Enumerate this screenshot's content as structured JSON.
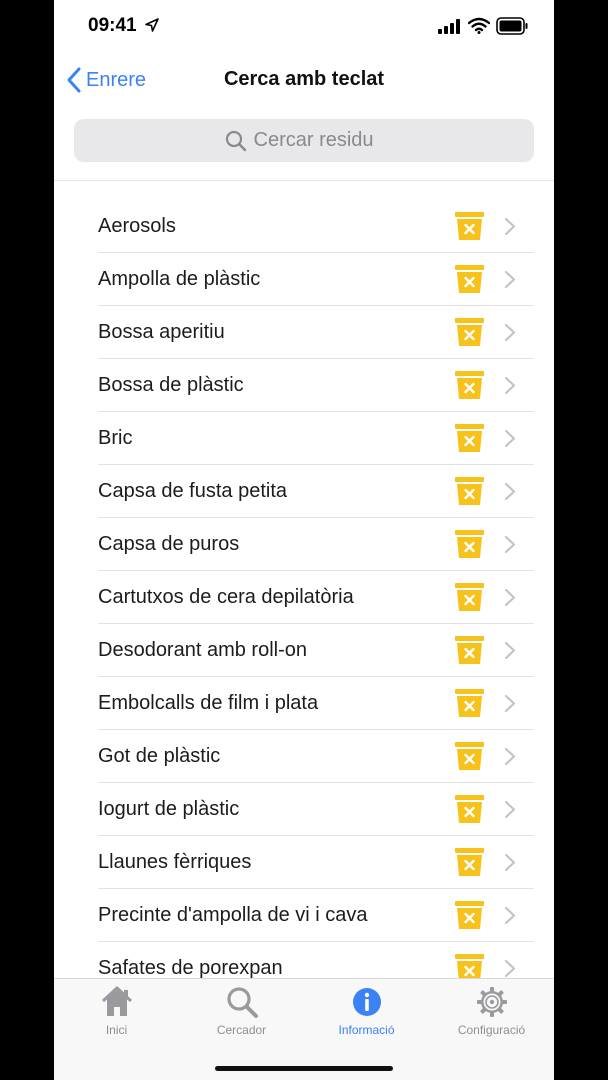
{
  "status_bar": {
    "time": "09:41"
  },
  "nav": {
    "back_label": "Enrere",
    "title": "Cerca amb teclat"
  },
  "search": {
    "placeholder": "Cercar residu"
  },
  "colors": {
    "accent": "#3b82f6",
    "bin_yellow": "#f8c21c",
    "gray_icon": "#9a9a9e"
  },
  "items": [
    {
      "label": "Aerosols",
      "icon": "yellow-bin-icon"
    },
    {
      "label": "Ampolla de plàstic",
      "icon": "yellow-bin-icon"
    },
    {
      "label": "Bossa aperitiu",
      "icon": "yellow-bin-icon"
    },
    {
      "label": "Bossa de plàstic",
      "icon": "yellow-bin-icon"
    },
    {
      "label": "Bric",
      "icon": "yellow-bin-icon"
    },
    {
      "label": "Capsa de fusta petita",
      "icon": "yellow-bin-icon"
    },
    {
      "label": "Capsa de puros",
      "icon": "yellow-bin-icon"
    },
    {
      "label": "Cartutxos de cera depilatòria",
      "icon": "yellow-bin-icon"
    },
    {
      "label": "Desodorant amb roll-on",
      "icon": "yellow-bin-icon"
    },
    {
      "label": "Embolcalls de film i plata",
      "icon": "yellow-bin-icon"
    },
    {
      "label": "Got de plàstic",
      "icon": "yellow-bin-icon"
    },
    {
      "label": "Iogurt de plàstic",
      "icon": "yellow-bin-icon"
    },
    {
      "label": "Llaunes fèrriques",
      "icon": "yellow-bin-icon"
    },
    {
      "label": "Precinte d'ampolla de vi i cava",
      "icon": "yellow-bin-icon"
    },
    {
      "label": "Safates de porexpan",
      "icon": "yellow-bin-icon"
    }
  ],
  "tabs": [
    {
      "label": "Inici",
      "icon": "home-icon",
      "active": false
    },
    {
      "label": "Cercador",
      "icon": "search-icon",
      "active": false
    },
    {
      "label": "Informació",
      "icon": "info-icon",
      "active": true
    },
    {
      "label": "Configuració",
      "icon": "gear-icon",
      "active": false
    }
  ]
}
